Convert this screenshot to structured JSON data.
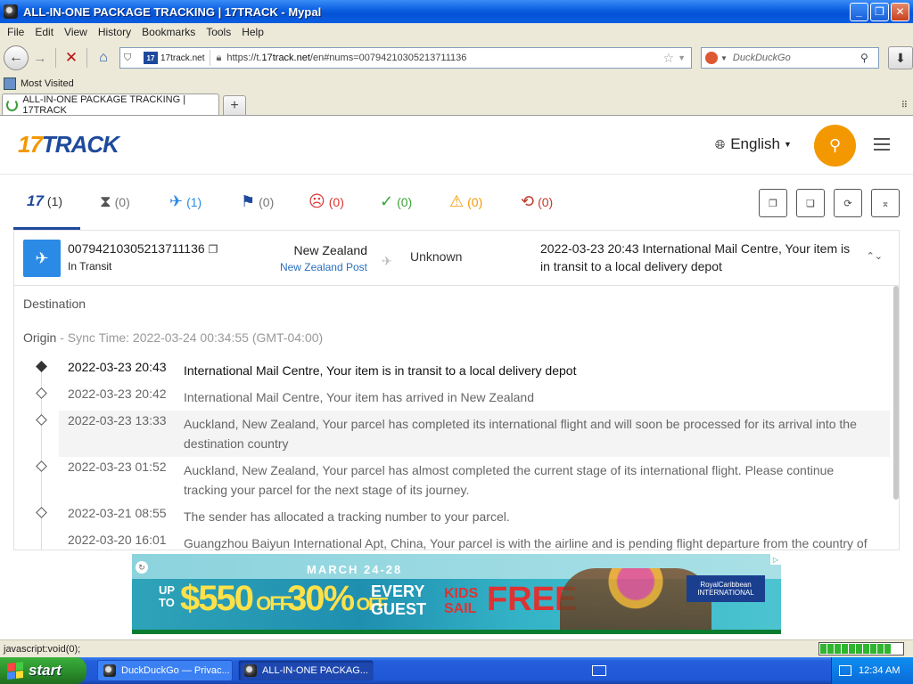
{
  "window": {
    "title": "ALL-IN-ONE PACKAGE TRACKING | 17TRACK - Mypal",
    "minimize": "_",
    "maximize": "❐",
    "close": "✕"
  },
  "menu": [
    "File",
    "Edit",
    "View",
    "History",
    "Bookmarks",
    "Tools",
    "Help"
  ],
  "nav": {
    "site_badge": "17track.net",
    "site_logo": "17",
    "url_prefix": "https://t.",
    "url_host": "17track.net",
    "url_rest": "/en#nums=00794210305213711136",
    "search_placeholder": "DuckDuckGo"
  },
  "bookmarks": {
    "most_visited": "Most Visited"
  },
  "tabs": [
    {
      "label": "ALL-IN-ONE PACKAGE TRACKING | 17TRACK"
    }
  ],
  "site": {
    "logo_num": "17",
    "logo_txt": "TRACK",
    "language": "English"
  },
  "filters": [
    {
      "name": "all",
      "icon": "17",
      "count": "(1)",
      "color": "#1e4a9c"
    },
    {
      "name": "pending",
      "icon": "⧗",
      "count": "(0)",
      "color": "#555555"
    },
    {
      "name": "in-transit",
      "icon": "✈",
      "count": "(1)",
      "color": "#2a8ae6"
    },
    {
      "name": "pickup",
      "icon": "⚑",
      "count": "(0)",
      "color": "#1e4a9c"
    },
    {
      "name": "undelivered",
      "icon": "☹",
      "count": "(0)",
      "color": "#d33333"
    },
    {
      "name": "delivered",
      "icon": "✓",
      "count": "(0)",
      "color": "#3aa33a"
    },
    {
      "name": "alert",
      "icon": "⚠",
      "count": "(0)",
      "color": "#f39800"
    },
    {
      "name": "expired",
      "icon": "⟲",
      "count": "(0)",
      "color": "#c0392b"
    }
  ],
  "package": {
    "tracking_number": "00794210305213711136",
    "status": "In Transit",
    "origin_country": "New Zealand",
    "origin_carrier": "New Zealand Post",
    "destination": "Unknown",
    "latest_event": "2022-03-23 20:43  International Mail Centre, Your item is in transit to a local delivery depot",
    "label_destination": "Destination",
    "label_origin": "Origin",
    "sync_text": " - Sync Time: 2022-03-24 00:34:55 (GMT-04:00)"
  },
  "events": [
    {
      "time": "2022-03-23 20:43",
      "desc": "International Mail Centre, Your item is in transit to a local delivery depot"
    },
    {
      "time": "2022-03-23 20:42",
      "desc": "International Mail Centre, Your item has arrived in New Zealand"
    },
    {
      "time": "2022-03-23 13:33",
      "desc": "Auckland, New Zealand, Your parcel has completed its international flight and will soon be processed for its arrival into the destination country"
    },
    {
      "time": "2022-03-23 01:52",
      "desc": "Auckland, New Zealand, Your parcel has almost completed the current stage of its international flight. Please continue tracking your parcel for the next stage of its journey."
    },
    {
      "time": "2022-03-21 08:55",
      "desc": "The sender has allocated a tracking number to your parcel."
    },
    {
      "time": "2022-03-20 16:01",
      "desc": "Guangzhou Baiyun International Apt, China, Your parcel is with the airline and is pending flight departure from the country of"
    }
  ],
  "ad": {
    "date": "MARCH 24-28",
    "upto": "UP\nTO",
    "amount": "$550",
    "off1": "OFF",
    "pct": "30%",
    "off2": "OFF",
    "every": "EVERY\nGUEST",
    "kids": "KIDS\nSAIL",
    "free": "FREE",
    "brand": "RoyalCaribbean INTERNATIONAL"
  },
  "status_text": "javascript:void(0);",
  "progress": 0.95,
  "taskbar": {
    "start": "start",
    "tasks": [
      "DuckDuckGo — Privac...",
      "ALL-IN-ONE PACKAG..."
    ],
    "clock": "12:34 AM"
  }
}
